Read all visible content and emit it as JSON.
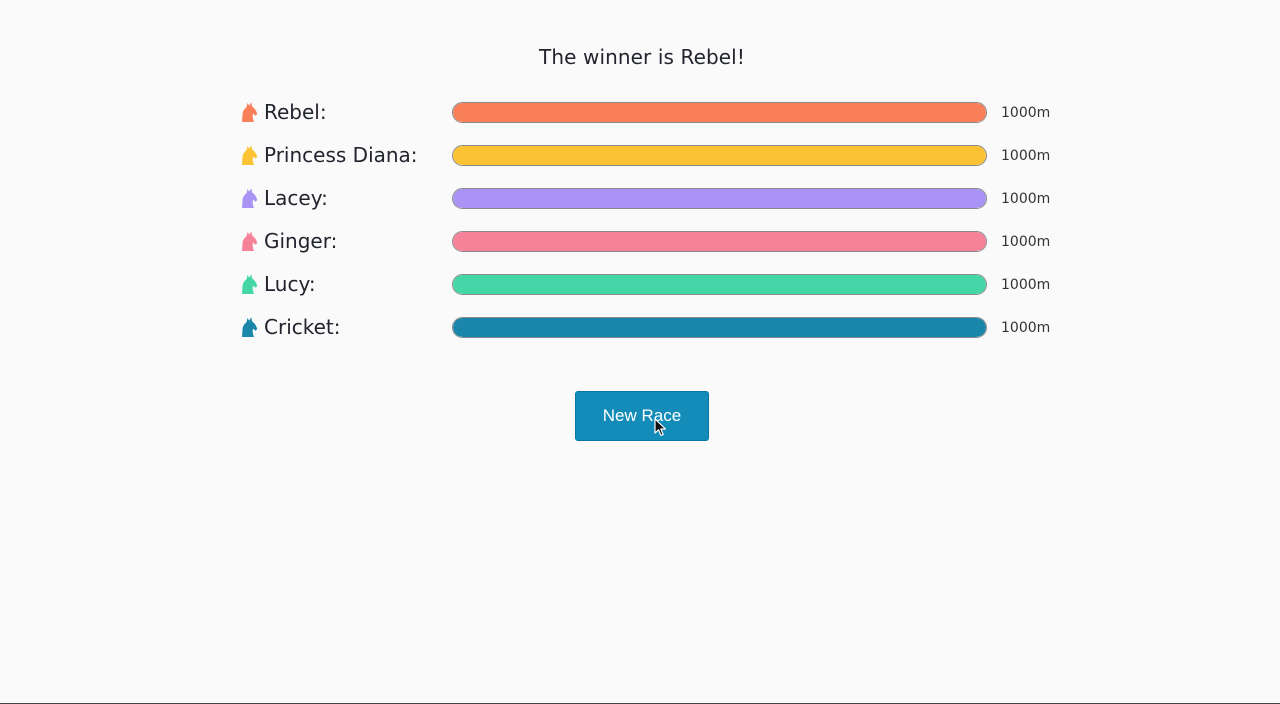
{
  "winner_text": "The winner is Rebel!",
  "horses": [
    {
      "name": "Rebel:",
      "distance": "1000m",
      "progress": 1.0,
      "color": "#f87f58",
      "icon": "horse-head-icon"
    },
    {
      "name": "Princess Diana:",
      "distance": "1000m",
      "progress": 1.0,
      "color": "#fbc233",
      "icon": "horse-head-icon"
    },
    {
      "name": "Lacey:",
      "distance": "1000m",
      "progress": 1.0,
      "color": "#a993f4",
      "icon": "horse-head-icon"
    },
    {
      "name": "Ginger:",
      "distance": "1000m",
      "progress": 1.0,
      "color": "#f6829a",
      "icon": "horse-head-icon"
    },
    {
      "name": "Lucy:",
      "distance": "1000m",
      "progress": 1.0,
      "color": "#44d6a6",
      "icon": "horse-head-icon"
    },
    {
      "name": "Cricket:",
      "distance": "1000m",
      "progress": 1.0,
      "color": "#1a86aa",
      "icon": "horse-head-icon"
    }
  ],
  "new_race_label": "New Race"
}
